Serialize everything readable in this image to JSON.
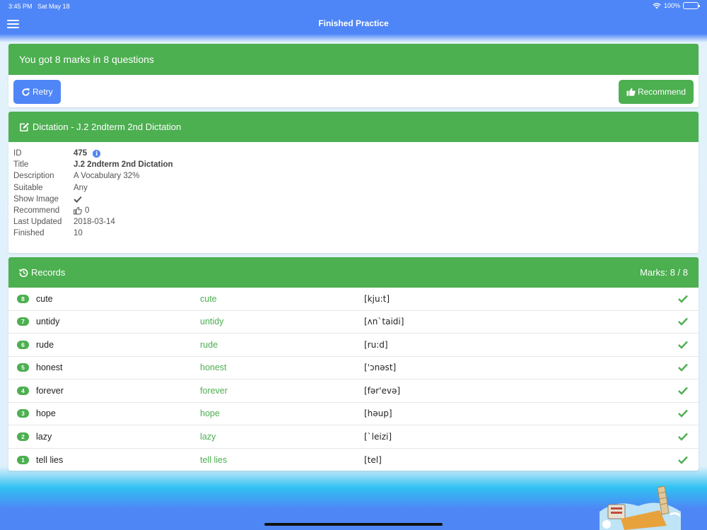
{
  "status_bar": {
    "time": "3:45 PM",
    "date": "Sat May 18",
    "battery": "100%"
  },
  "nav": {
    "title": "Finished Practice",
    "menu_icon": "hamburger-icon"
  },
  "result": {
    "summary": "You got 8 marks in 8 questions",
    "retry_label": "Retry",
    "recommend_label": "Recommend"
  },
  "dictation": {
    "header": "Dictation - J.2 2ndterm 2nd Dictation",
    "fields": {
      "id": {
        "label": "ID",
        "value": "475"
      },
      "title": {
        "label": "Title",
        "value": "J.2 2ndterm 2nd Dictation"
      },
      "description": {
        "label": "Description",
        "value": "A Vocabulary 32%"
      },
      "suitable": {
        "label": "Suitable",
        "value": "Any"
      },
      "show_image": {
        "label": "Show Image",
        "value": true
      },
      "recommend": {
        "label": "Recommend",
        "value": "0"
      },
      "last_updated": {
        "label": "Last Updated",
        "value": "2018-03-14"
      },
      "finished": {
        "label": "Finished",
        "value": "10"
      }
    }
  },
  "records": {
    "header": "Records",
    "marks": "Marks: 8 / 8",
    "items": [
      {
        "num": "8",
        "word": "cute",
        "answer": "cute",
        "phonetic": "[kju:t]",
        "correct": true
      },
      {
        "num": "7",
        "word": "untidy",
        "answer": "untidy",
        "phonetic": "[ʌn`taidi]",
        "correct": true
      },
      {
        "num": "6",
        "word": "rude",
        "answer": "rude",
        "phonetic": "[ru:d]",
        "correct": true
      },
      {
        "num": "5",
        "word": "honest",
        "answer": "honest",
        "phonetic": "['ɔnəst]",
        "correct": true
      },
      {
        "num": "4",
        "word": "forever",
        "answer": "forever",
        "phonetic": "[fər'evə]",
        "correct": true
      },
      {
        "num": "3",
        "word": "hope",
        "answer": "hope",
        "phonetic": "[həup]",
        "correct": true
      },
      {
        "num": "2",
        "word": "lazy",
        "answer": "lazy",
        "phonetic": "[`leizi]",
        "correct": true
      },
      {
        "num": "1",
        "word": "tell lies",
        "answer": "tell lies",
        "phonetic": "[tel]",
        "correct": true
      }
    ]
  },
  "colors": {
    "primary": "#4f86f7",
    "success": "#4caf50",
    "background": "#e3f2fb"
  }
}
